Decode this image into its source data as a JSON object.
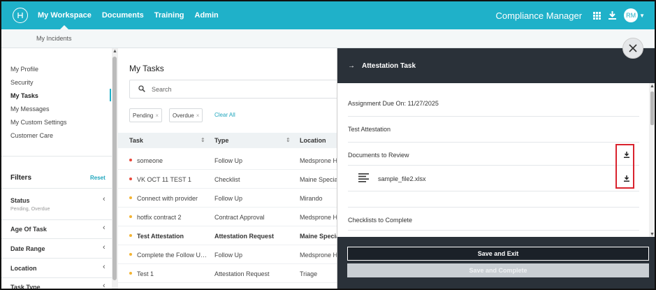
{
  "nav": {
    "items": [
      "My Workspace",
      "Documents",
      "Training",
      "Admin"
    ],
    "brand": "Compliance Manager",
    "avatar": "RM"
  },
  "subnav": {
    "label": "My Incidents"
  },
  "sidebar": {
    "links": [
      "My Profile",
      "Security",
      "My Tasks",
      "My Messages",
      "My Custom Settings",
      "Customer Care"
    ],
    "active": "My Tasks",
    "filters_title": "Filters",
    "reset_label": "Reset",
    "filters": [
      {
        "label": "Status",
        "value": "Pending, Overdue"
      },
      {
        "label": "Age Of Task",
        "value": ""
      },
      {
        "label": "Date Range",
        "value": ""
      },
      {
        "label": "Location",
        "value": ""
      },
      {
        "label": "Task Type",
        "value": ""
      }
    ]
  },
  "main": {
    "title": "My Tasks",
    "search_placeholder": "Search",
    "chips": [
      "Pending",
      "Overdue"
    ],
    "clear_all": "Clear All",
    "columns": [
      "Task",
      "Type",
      "Location"
    ],
    "rows": [
      {
        "task": "someone",
        "type": "Follow Up",
        "location": "Medsprone H",
        "status": "overdue"
      },
      {
        "task": "VK OCT 11 TEST 1",
        "type": "Checklist",
        "location": "Maine Specia",
        "status": "overdue"
      },
      {
        "task": "Connect with provider",
        "type": "Follow Up",
        "location": "Mirando",
        "status": "pending"
      },
      {
        "task": "hotfix contract 2",
        "type": "Contract Approval",
        "location": "Medsprone H",
        "status": "pending"
      },
      {
        "task": "Test Attestation",
        "type": "Attestation Request",
        "location": "Maine Specia",
        "status": "pending",
        "selected": true
      },
      {
        "task": "Complete the Follow Up ...",
        "type": "Follow Up",
        "location": "Medsprone H",
        "status": "pending"
      },
      {
        "task": "Test 1",
        "type": "Attestation Request",
        "location": "Triage",
        "status": "pending"
      }
    ]
  },
  "panel": {
    "title": "Attestation Task",
    "due": "Assignment Due On: 11/27/2025",
    "task_name": "Test Attestation",
    "documents_heading": "Documents to Review",
    "document_name": "sample_file2.xlsx",
    "checklists_heading": "Checklists to Complete",
    "save_exit": "Save and Exit",
    "save_complete": "Save and Complete"
  },
  "colors": {
    "brand": "#1fb1c9",
    "overdue": "#e8483b",
    "pending": "#f3b433",
    "panel_dark": "#2a3139",
    "highlight": "#d9232e"
  }
}
